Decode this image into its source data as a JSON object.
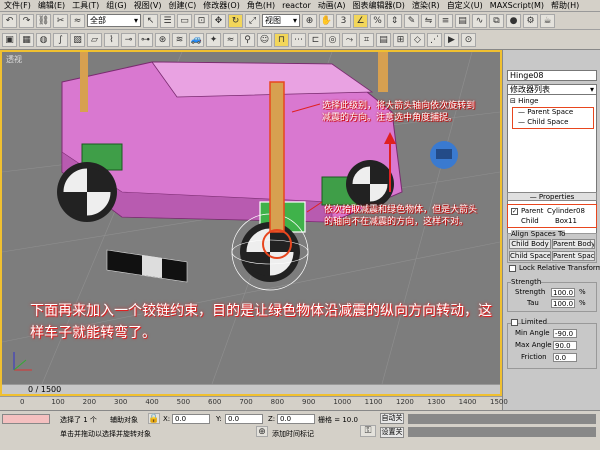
{
  "menu": [
    "文件(F)",
    "编辑(E)",
    "工具(T)",
    "组(G)",
    "视图(V)",
    "创建(C)",
    "修改器(O)",
    "角色(H)",
    "reactor",
    "动画(A)",
    "图表编辑器(D)",
    "渲染(R)",
    "自定义(U)",
    "MAXScript(M)",
    "帮助(H)"
  ],
  "toolbar": {
    "filter_value": "全部",
    "view_value": "视图"
  },
  "viewport": {
    "label": "透视",
    "frame_counter": "0 / 1500",
    "note_top": "选择此级别，将大箭头轴向依次旋转到减震的方向。注意选中角度捕捉。",
    "note_mid": "依次拾取减震和绿色物体，但是大箭头的轴向不在减震的方向，这样不对。",
    "note_bottom": "下面再来加入一个铰链约束，目的是让绿色物体沿减震的纵向方向转动，这样车子就能转弯了。"
  },
  "panel": {
    "object_name": "Hinge08",
    "modifier_list": "修改器列表",
    "stack": {
      "hinge": "Hinge",
      "parent_space": "Parent Space",
      "child_space": "Child Space"
    },
    "properties": {
      "title": "Properties",
      "parent_label": "Parent",
      "parent_value": "Cylinder08",
      "child_label": "Child",
      "child_value": "Box11",
      "align_title": "Align Spaces To",
      "child_body": "Child Body",
      "parent_body": "Parent Body",
      "child_space_btn": "Child Space",
      "parent_space_btn": "Parent Space",
      "lock_relative": "Lock Relative Transform",
      "strength_title": "Strength",
      "strength_label": "Strength",
      "strength_value": "100.0",
      "tau_label": "Tau",
      "tau_value": "100.0",
      "pct": "%",
      "limited_label": "Limited",
      "min_angle_label": "Min Angle",
      "min_angle_value": "-90.0",
      "max_angle_label": "Max Angle",
      "max_angle_value": "90.0",
      "friction_label": "Friction",
      "friction_value": "0.0"
    }
  },
  "timeline": {
    "ticks": [
      "0",
      "100",
      "200",
      "300",
      "400",
      "500",
      "600",
      "700",
      "800",
      "900",
      "1000",
      "1100",
      "1200",
      "1300",
      "1400",
      "1500"
    ]
  },
  "status": {
    "selected": "选择了 1 个",
    "helper": "辅助对象",
    "x_label": "X:",
    "x_value": "0.0",
    "y_label": "Y:",
    "y_value": "0.0",
    "z_label": "Z:",
    "z_value": "0.0",
    "grid": "栅格 = 10.0",
    "auto_key": "自动关",
    "set_key": "设置关",
    "hint": "单击并拖动以选择并旋转对象",
    "add_time_tag": "添加时间标记"
  }
}
